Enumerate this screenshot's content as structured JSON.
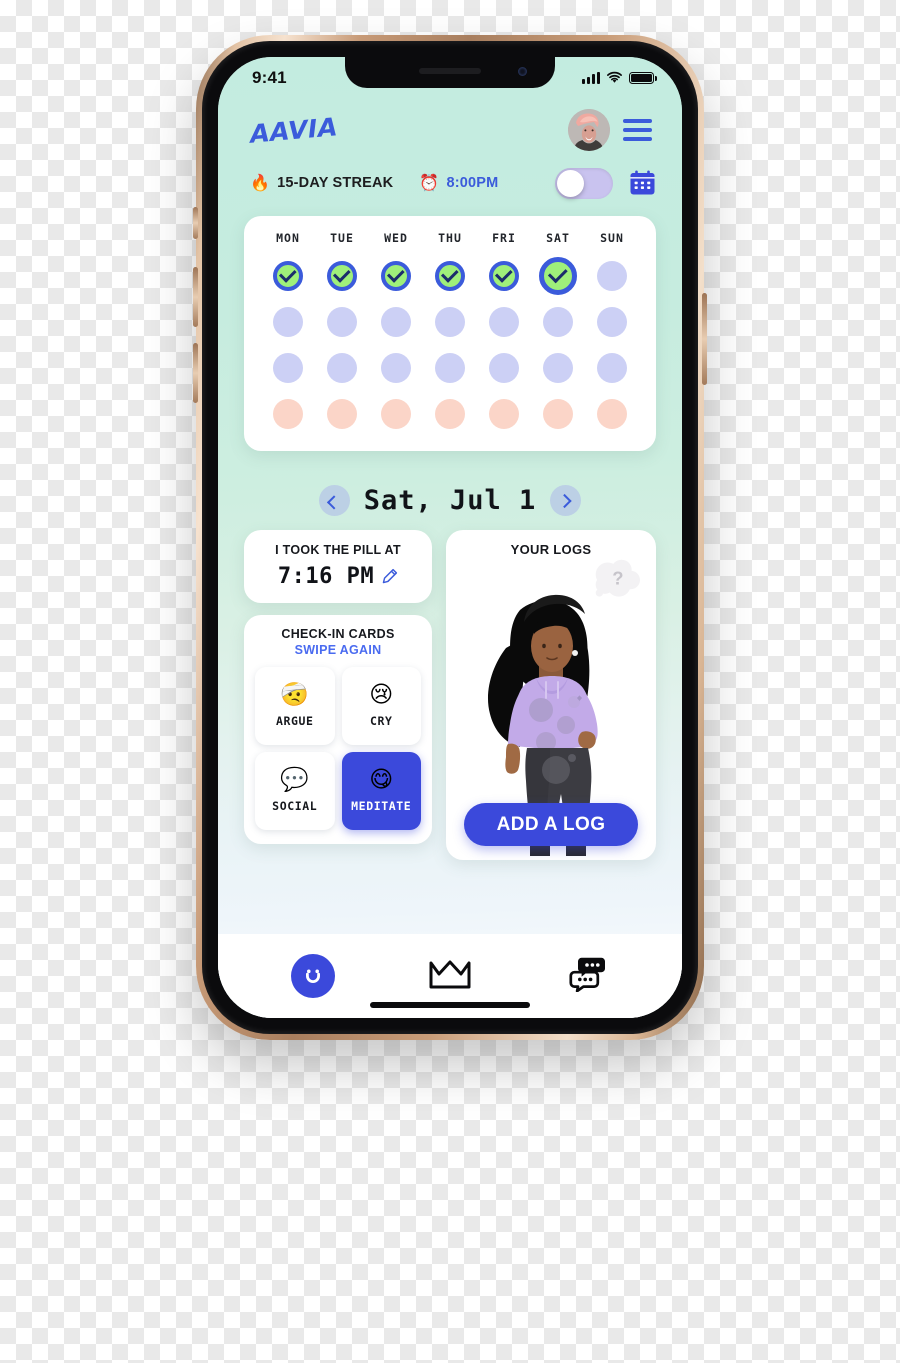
{
  "status_bar": {
    "time": "9:41",
    "signal_icon": "cellular-signal-icon",
    "wifi_icon": "wifi-icon",
    "battery_icon": "battery-icon"
  },
  "header": {
    "logo": "AAVIA",
    "avatar_icon": "user-avatar",
    "menu_icon": "hamburger-menu-icon"
  },
  "streak_row": {
    "fire_icon": "🔥",
    "streak_text": "15-DAY STREAK",
    "alarm_icon": "⏰",
    "reminder_time": "8:00PM",
    "toggle_state": "off",
    "toggle_icon": "reminder-toggle",
    "calendar_icon": "calendar-icon"
  },
  "calendar": {
    "day_labels": [
      "MON",
      "TUE",
      "WED",
      "THU",
      "FRI",
      "SAT",
      "SUN"
    ],
    "rows": [
      {
        "name": "week-1",
        "cells": [
          "done",
          "done",
          "done",
          "done",
          "done",
          "done-today",
          "lavender"
        ]
      },
      {
        "name": "week-2",
        "cells": [
          "lavender",
          "lavender",
          "lavender",
          "lavender",
          "lavender",
          "lavender",
          "lavender"
        ]
      },
      {
        "name": "week-3",
        "cells": [
          "lavender",
          "lavender",
          "lavender",
          "lavender",
          "lavender",
          "lavender",
          "lavender"
        ]
      },
      {
        "name": "week-4",
        "cells": [
          "peach",
          "peach",
          "peach",
          "peach",
          "peach",
          "peach",
          "peach"
        ]
      }
    ],
    "colors": {
      "done_fill": "#9ff07a",
      "done_ring": "#3b5bdb",
      "lavender": "#ccd0f5",
      "peach": "#fbd5c8"
    }
  },
  "date_nav": {
    "prev_icon": "chevron-left-icon",
    "next_icon": "chevron-right-icon",
    "current_date": "Sat, Jul 1"
  },
  "pill_card": {
    "label": "I TOOK THE PILL AT",
    "time": "7:16 PM",
    "edit_icon": "pencil-edit-icon"
  },
  "checkin_card": {
    "title": "CHECK-IN CARDS",
    "subtitle": "SWIPE AGAIN",
    "chips": [
      {
        "emoji": "🤕",
        "label": "ARGUE",
        "selected": false,
        "icon": "head-bandage-emoji"
      },
      {
        "emoji": "😢",
        "label": "CRY",
        "selected": false,
        "icon": "crying-face-emoji"
      },
      {
        "emoji": "💬",
        "label": "SOCIAL",
        "selected": false,
        "icon": "speech-bubble-emoji"
      },
      {
        "emoji": "😋",
        "label": "MEDITATE",
        "selected": true,
        "icon": "savoring-face-emoji"
      }
    ],
    "selected_color": "#3b49db"
  },
  "logs_card": {
    "title": "YOUR LOGS",
    "thought_bubble": "?",
    "illustration": "woman-standing-illustration",
    "button_label": "ADD A LOG",
    "button_color": "#3b49db"
  },
  "tab_bar": {
    "tabs": [
      {
        "name": "tab-home",
        "icon": "smiley-face-icon",
        "active": true
      },
      {
        "name": "tab-rewards",
        "icon": "crown-icon",
        "active": false
      },
      {
        "name": "tab-chat",
        "icon": "chat-bubbles-icon",
        "active": false
      }
    ]
  }
}
